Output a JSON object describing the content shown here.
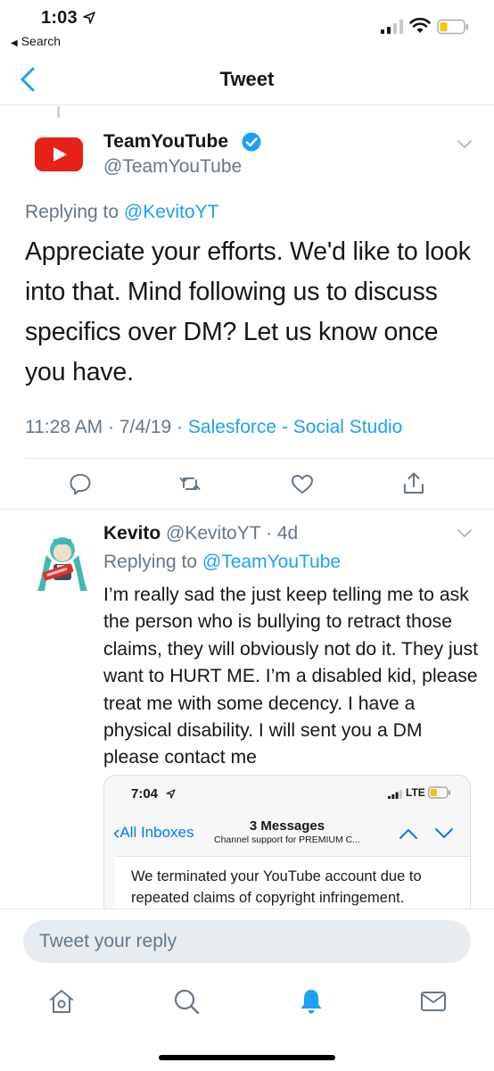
{
  "status_bar": {
    "time": "1:03",
    "back_app": "Search"
  },
  "nav": {
    "title": "Tweet"
  },
  "main_tweet": {
    "display_name": "TeamYouTube",
    "handle": "@TeamYouTube",
    "replying_prefix": "Replying to ",
    "replying_to": "@KevitoYT",
    "text": "Appreciate your efforts. We'd like to look into that. Mind following us to discuss specifics over DM? Let us know once you have.",
    "timestamp": "11:28 AM · 7/4/19 · ",
    "source": "Salesforce - Social Studio"
  },
  "actions": [
    "reply-icon",
    "retweet-icon",
    "like-icon",
    "share-icon"
  ],
  "reply_tweet": {
    "display_name": "Kevito",
    "handle_time": " @KevitoYT · 4d",
    "replying_prefix": "Replying to ",
    "replying_to": "@TeamYouTube",
    "text": "I’m really sad the just keep telling me to ask the person who is bullying to retract those claims, they will obviously not do it. They just want to HURT ME. I’m a disabled kid, please treat me with some decency. I have a physical disability. I will sent you a DM please contact me",
    "embedded": {
      "time": "7:04",
      "network": "LTE",
      "back_label": "All Inboxes",
      "title": "3 Messages",
      "subtitle": "Channel support for PREMIUM C...",
      "message": "We terminated your YouTube account due to repeated claims of copyright infringement."
    }
  },
  "composer": {
    "placeholder": "Tweet your reply"
  },
  "tab_bar": {
    "items": [
      "home-icon",
      "search-icon",
      "notifications-icon",
      "messages-icon"
    ],
    "active": "notifications-icon"
  },
  "colors": {
    "accent": "#1da1f2",
    "secondary_text": "#657786",
    "youtube_red": "#e62117",
    "ios_blue": "#007aff"
  }
}
